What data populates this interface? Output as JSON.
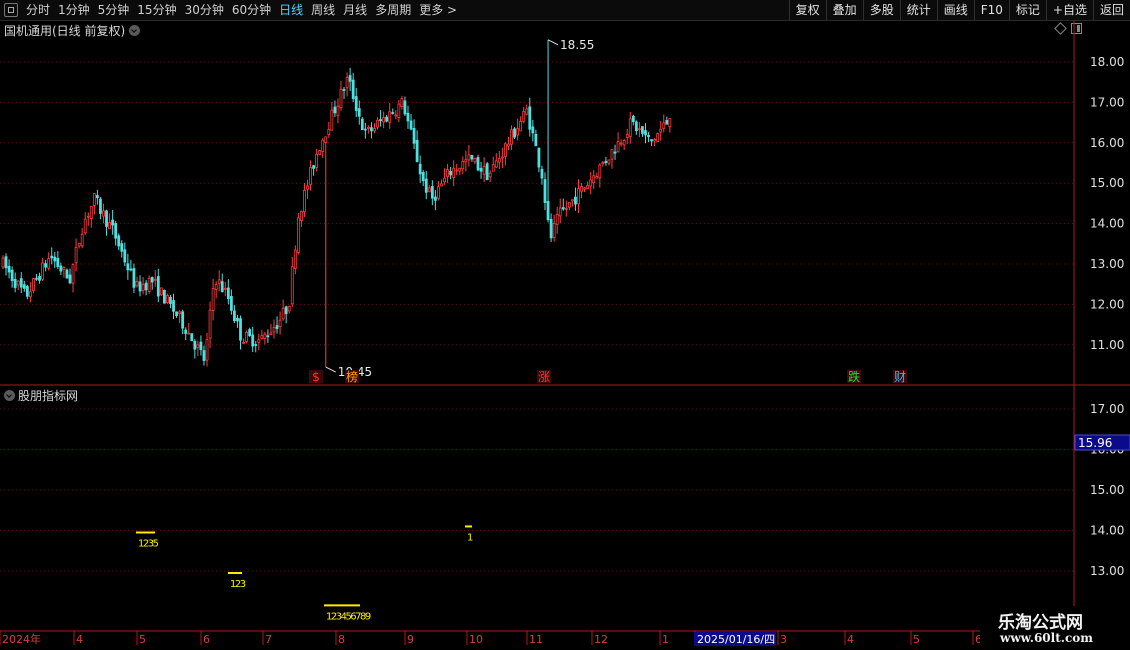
{
  "toolbar": {
    "tabs": [
      {
        "label": "分时",
        "active": false
      },
      {
        "label": "1分钟",
        "active": false
      },
      {
        "label": "5分钟",
        "active": false
      },
      {
        "label": "15分钟",
        "active": false
      },
      {
        "label": "30分钟",
        "active": false
      },
      {
        "label": "60分钟",
        "active": false
      },
      {
        "label": "日线",
        "active": true
      },
      {
        "label": "周线",
        "active": false
      },
      {
        "label": "月线",
        "active": false
      },
      {
        "label": "多周期",
        "active": false
      },
      {
        "label": "更多 >",
        "active": false
      }
    ],
    "buttons": [
      "复权",
      "叠加",
      "多股",
      "统计",
      "画线",
      "F10",
      "标记",
      "+自选",
      "返回"
    ]
  },
  "main_panel": {
    "title": "国机通用(日线 前复权)",
    "high_label": "18.55",
    "low_label": "10.45",
    "markers": [
      {
        "text": "$",
        "color": "#ff3030"
      },
      {
        "text": "榜",
        "color": "#ffa000"
      },
      {
        "text": "涨",
        "color": "#ff3030"
      },
      {
        "text": "跌",
        "color": "#20e020"
      },
      {
        "text": "财",
        "color": "#4aa8ff"
      }
    ]
  },
  "indicator_panel": {
    "title": "股朋指标网",
    "price_tag": "15.96",
    "signals": [
      {
        "label": "1235"
      },
      {
        "label": "123"
      },
      {
        "label": "1"
      },
      {
        "label": "123456789"
      }
    ]
  },
  "chart_data": {
    "type": "candlestick",
    "main_y_ticks": [
      "18.00",
      "17.00",
      "16.00",
      "15.00",
      "14.00",
      "13.00",
      "12.00",
      "11.00"
    ],
    "indicator_y_ticks": [
      "17.00",
      "16.00",
      "15.00",
      "14.00",
      "13.00"
    ],
    "x_labels": [
      "2024年",
      "4",
      "5",
      "6",
      "7",
      "8",
      "9",
      "10",
      "11",
      "12",
      "1",
      "2025/01/16/四",
      "3",
      "4",
      "5",
      "6"
    ],
    "low_value": 10.45,
    "high_value": 18.55,
    "last_value": 16.6,
    "colors": {
      "up": "#ff3c3c",
      "down": "#4fe0e0",
      "grid": "#5a1010",
      "axis": "#b01818",
      "label": "#e0e0e0"
    }
  },
  "watermark": {
    "name": "乐淘公式网",
    "url": "www.60lt.com"
  }
}
